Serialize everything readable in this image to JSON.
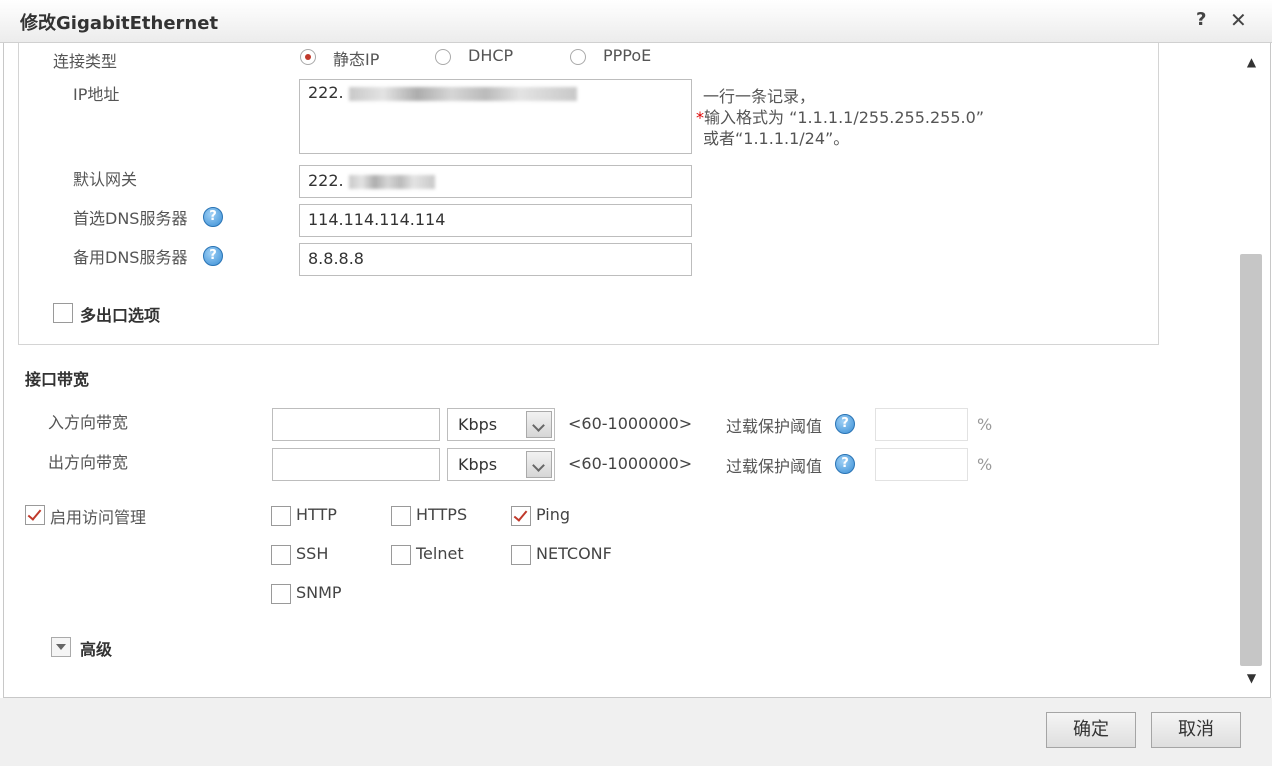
{
  "window": {
    "title": "修改GigabitEthernet",
    "help_icon": "?",
    "close_icon": "✕"
  },
  "connection": {
    "label": "连接类型",
    "options": [
      {
        "label": "静态IP",
        "checked": true
      },
      {
        "label": "DHCP",
        "checked": false
      },
      {
        "label": "PPPoE",
        "checked": false
      }
    ]
  },
  "ip_address": {
    "label": "IP地址",
    "value": "222.",
    "hint_line1": "一行一条记录，",
    "hint_required": "*",
    "hint_line2": "输入格式为 “1.1.1.1/255.255.255.0”",
    "hint_line3": "或者“1.1.1.1/24”。"
  },
  "gateway": {
    "label": "默认网关",
    "value": "222."
  },
  "dns_primary": {
    "label": "首选DNS服务器",
    "value": "114.114.114.114"
  },
  "dns_backup": {
    "label": "备用DNS服务器",
    "value": "8.8.8.8"
  },
  "multi_exit": {
    "label": "多出口选项",
    "checked": false
  },
  "bandwidth": {
    "section_title": "接口带宽",
    "rows": [
      {
        "label": "入方向带宽",
        "value": "",
        "unit": "Kbps",
        "range": "<60-1000000>",
        "threshold_label": "过载保护阈值",
        "threshold_value": "",
        "percent": "%"
      },
      {
        "label": "出方向带宽",
        "value": "",
        "unit": "Kbps",
        "range": "<60-1000000>",
        "threshold_label": "过载保护阈值",
        "threshold_value": "",
        "percent": "%"
      }
    ]
  },
  "access": {
    "label": "启用访问管理",
    "checked": true,
    "protocols": [
      {
        "label": "HTTP",
        "checked": false
      },
      {
        "label": "HTTPS",
        "checked": false
      },
      {
        "label": "Ping",
        "checked": true
      },
      {
        "label": "SSH",
        "checked": false
      },
      {
        "label": "Telnet",
        "checked": false
      },
      {
        "label": "NETCONF",
        "checked": false
      },
      {
        "label": "SNMP",
        "checked": false
      }
    ]
  },
  "advanced": {
    "label": "高级"
  },
  "footer": {
    "ok_label": "确定",
    "cancel_label": "取消"
  },
  "colors": {
    "accent": "#c0392b",
    "help_blue": "#3a8fd6",
    "footer_bg": "#f0f0f0"
  },
  "icons": {
    "help": "help-icon",
    "close": "close-icon",
    "scroll_up": "scroll-up-arrow-icon",
    "scroll_down": "scroll-down-arrow-icon",
    "expander": "expand-triangle-icon",
    "dropdown": "chevron-down-icon"
  }
}
